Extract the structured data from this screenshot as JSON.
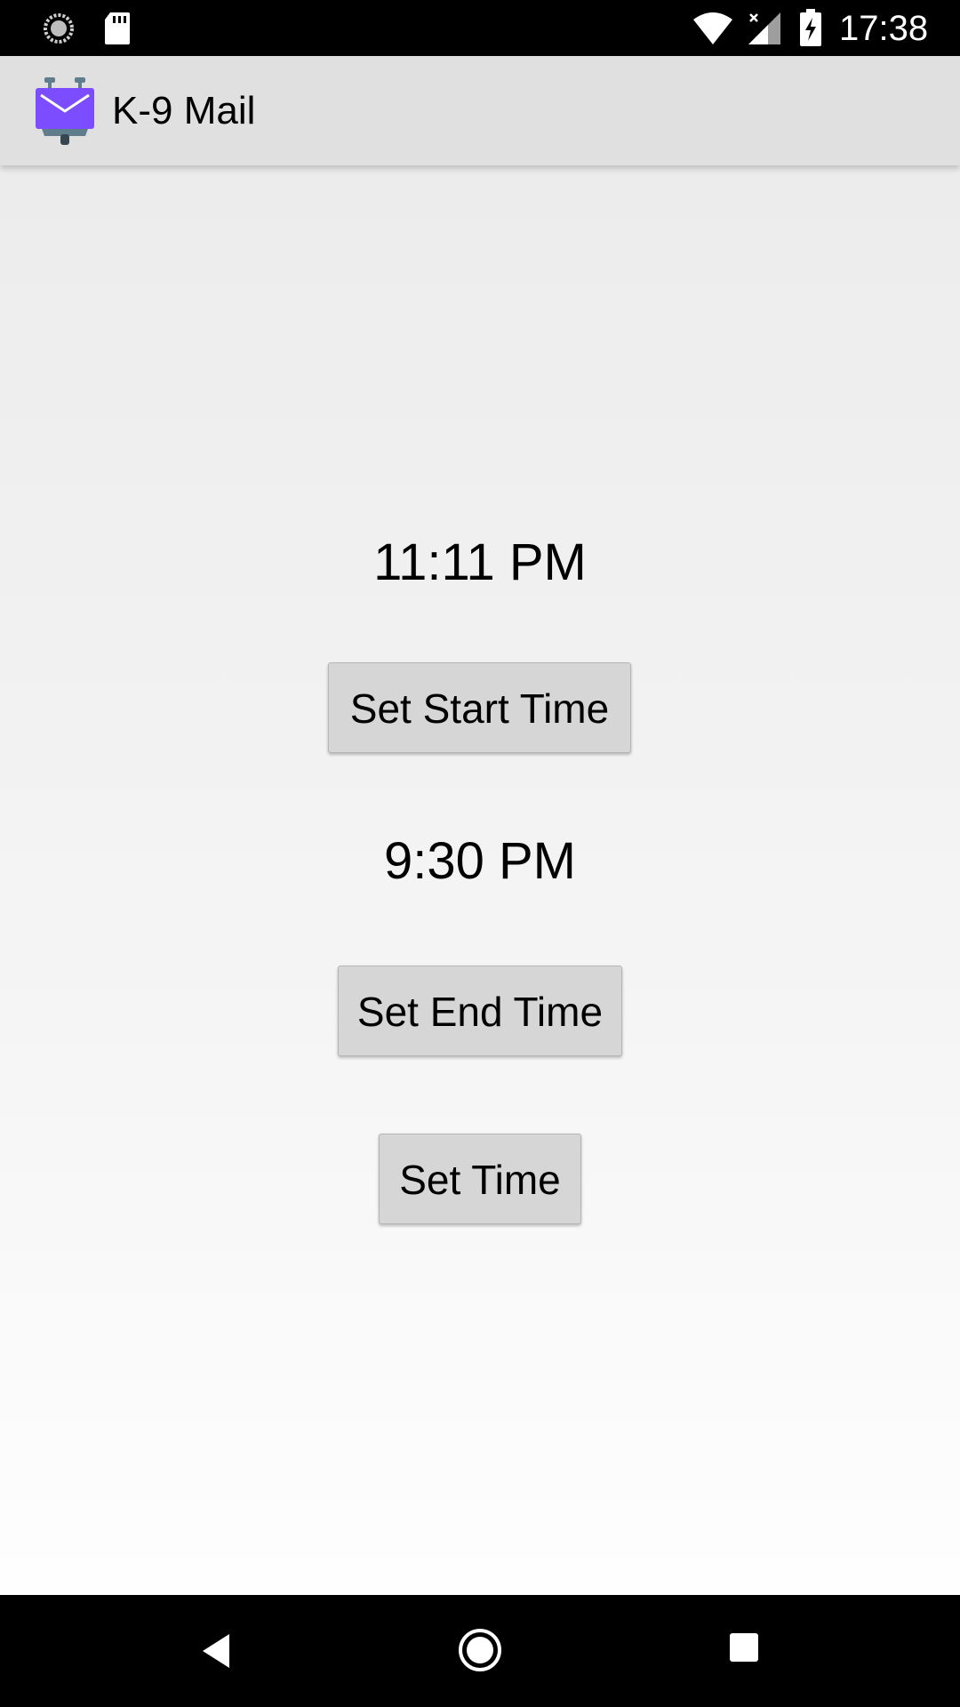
{
  "status_bar": {
    "time": "17:38",
    "icons": [
      "sync-icon",
      "sd-card-icon",
      "wifi-icon",
      "signal-icon",
      "battery-charging-icon"
    ]
  },
  "toolbar": {
    "app_icon": "k9-mail-app-icon",
    "title": "K-9 Mail",
    "brand_color": "#7C4DFF"
  },
  "content": {
    "start_time": "11:11 PM",
    "set_start_label": "Set Start Time",
    "end_time": "9:30 PM",
    "set_end_label": "Set End Time",
    "set_time_label": "Set Time"
  },
  "nav_bar": {
    "icons": [
      "back-icon",
      "home-icon",
      "recents-icon"
    ]
  }
}
